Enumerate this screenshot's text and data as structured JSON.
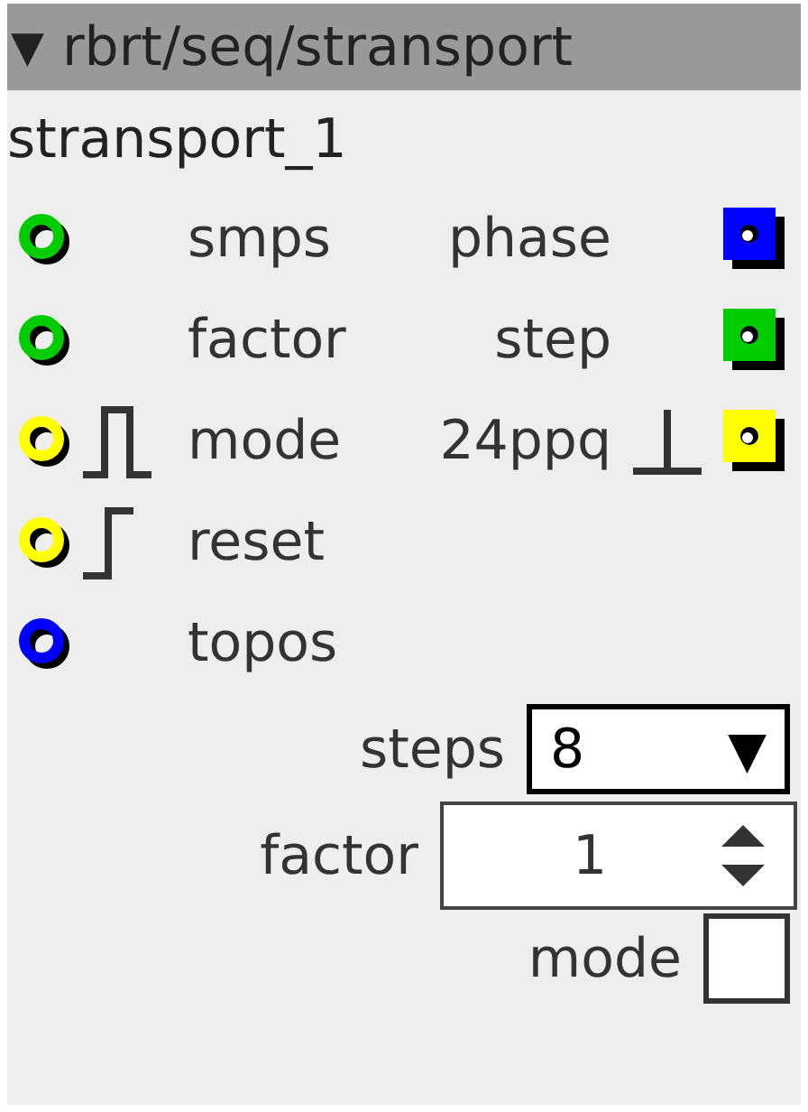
{
  "header": {
    "toggle": "▼",
    "title": "rbrt/seq/stransport"
  },
  "instance": "stransport_1",
  "ports": [
    {
      "input": {
        "name": "smps",
        "color": "#00cc00"
      },
      "output": {
        "name": "phase",
        "color": "#0000ff"
      }
    },
    {
      "input": {
        "name": "factor",
        "color": "#00cc00"
      },
      "output": {
        "name": "step",
        "color": "#00cc00"
      }
    },
    {
      "input": {
        "name": "mode",
        "color": "#ffff00",
        "kind": "pulse"
      },
      "output": {
        "name": "24ppq",
        "color": "#ffff00",
        "kind": "trigger"
      }
    },
    {
      "input": {
        "name": "reset",
        "color": "#ffff00",
        "kind": "step"
      }
    },
    {
      "input": {
        "name": "topos",
        "color": "#0000ff"
      }
    }
  ],
  "controls": [
    {
      "kind": "select",
      "label": "steps",
      "value": "8",
      "caret": "▼"
    },
    {
      "kind": "spin",
      "label": "factor",
      "value": "1"
    },
    {
      "kind": "checkbox",
      "label": "mode",
      "checked": false
    }
  ]
}
